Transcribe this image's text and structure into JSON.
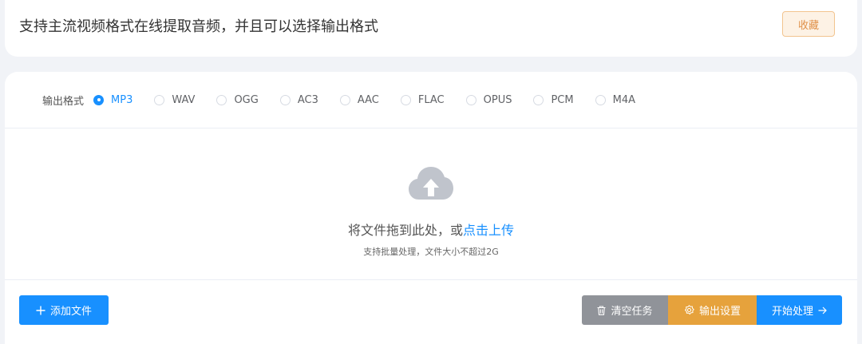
{
  "header": {
    "title": "支持主流视频格式在线提取音频，并且可以选择输出格式",
    "favorite_label": "收藏"
  },
  "formats": {
    "label": "输出格式",
    "selected": "MP3",
    "options": [
      "MP3",
      "WAV",
      "OGG",
      "AC3",
      "AAC",
      "FLAC",
      "OPUS",
      "PCM",
      "M4A"
    ]
  },
  "upload": {
    "prompt": "将文件拖到此处，或",
    "link": "点击上传",
    "hint": "支持批量处理，文件大小不超过2G"
  },
  "actions": {
    "add_label": "添加文件",
    "clear_label": "清空任务",
    "settings_label": "输出设置",
    "start_label": "开始处理"
  },
  "colors": {
    "primary": "#1890ff",
    "warning": "#e6a23c",
    "neutral": "#909399",
    "favorite": "#e0914a"
  }
}
